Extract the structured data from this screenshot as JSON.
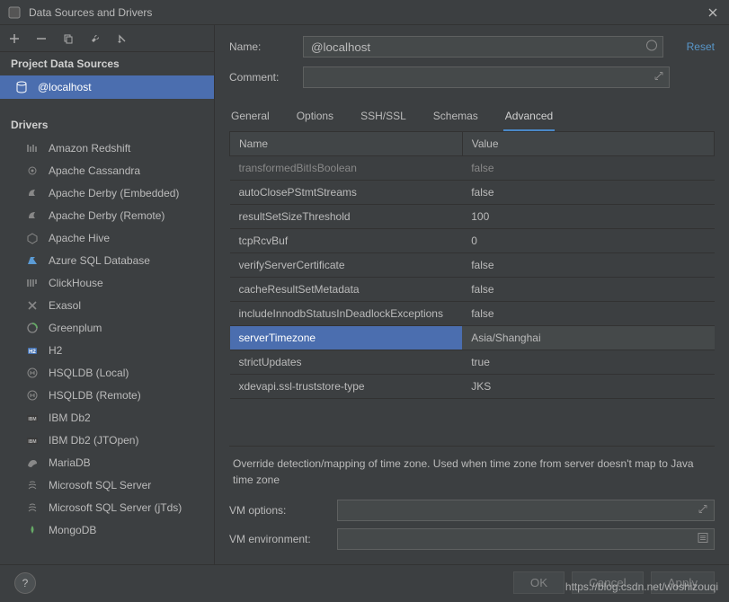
{
  "window": {
    "title": "Data Sources and Drivers"
  },
  "sidebar": {
    "sections": {
      "data_sources": "Project Data Sources",
      "drivers": "Drivers"
    },
    "data_source_items": [
      {
        "label": "@localhost"
      }
    ],
    "driver_items": [
      {
        "label": "Amazon Redshift",
        "icon": "redshift"
      },
      {
        "label": "Apache Cassandra",
        "icon": "cassandra"
      },
      {
        "label": "Apache Derby (Embedded)",
        "icon": "derby"
      },
      {
        "label": "Apache Derby (Remote)",
        "icon": "derby"
      },
      {
        "label": "Apache Hive",
        "icon": "hive"
      },
      {
        "label": "Azure SQL Database",
        "icon": "azure"
      },
      {
        "label": "ClickHouse",
        "icon": "clickhouse"
      },
      {
        "label": "Exasol",
        "icon": "exasol"
      },
      {
        "label": "Greenplum",
        "icon": "greenplum"
      },
      {
        "label": "H2",
        "icon": "h2"
      },
      {
        "label": "HSQLDB (Local)",
        "icon": "hsqldb"
      },
      {
        "label": "HSQLDB (Remote)",
        "icon": "hsqldb"
      },
      {
        "label": "IBM Db2",
        "icon": "db2"
      },
      {
        "label": "IBM Db2 (JTOpen)",
        "icon": "db2"
      },
      {
        "label": "MariaDB",
        "icon": "mariadb"
      },
      {
        "label": "Microsoft SQL Server",
        "icon": "mssql"
      },
      {
        "label": "Microsoft SQL Server (jTds)",
        "icon": "mssql"
      },
      {
        "label": "MongoDB",
        "icon": "mongo"
      }
    ]
  },
  "form": {
    "name_label": "Name:",
    "name_value": "@localhost",
    "comment_label": "Comment:",
    "comment_value": "",
    "reset": "Reset"
  },
  "tabs": [
    {
      "label": "General"
    },
    {
      "label": "Options"
    },
    {
      "label": "SSH/SSL"
    },
    {
      "label": "Schemas"
    },
    {
      "label": "Advanced",
      "active": true
    }
  ],
  "table": {
    "headers": {
      "name": "Name",
      "value": "Value"
    },
    "rows": [
      {
        "name": "transformedBitIsBoolean",
        "value": "false",
        "faded": true
      },
      {
        "name": "autoClosePStmtStreams",
        "value": "false"
      },
      {
        "name": "resultSetSizeThreshold",
        "value": "100"
      },
      {
        "name": "tcpRcvBuf",
        "value": "0"
      },
      {
        "name": "verifyServerCertificate",
        "value": "false"
      },
      {
        "name": "cacheResultSetMetadata",
        "value": "false"
      },
      {
        "name": "includeInnodbStatusInDeadlockExceptions",
        "value": "false"
      },
      {
        "name": "serverTimezone",
        "value": "Asia/Shanghai",
        "selected": true
      },
      {
        "name": "strictUpdates",
        "value": "true"
      },
      {
        "name": "xdevapi.ssl-truststore-type",
        "value": "JKS"
      }
    ]
  },
  "description": "Override detection/mapping of time zone. Used when time zone from server doesn't map to Java time zone",
  "vm": {
    "options_label": "VM options:",
    "options_value": "",
    "env_label": "VM environment:",
    "env_value": ""
  },
  "footer": {
    "ok": "OK",
    "cancel": "Cancel",
    "apply": "Apply"
  },
  "watermark": "https://blog.csdn.net/woshizouqi"
}
